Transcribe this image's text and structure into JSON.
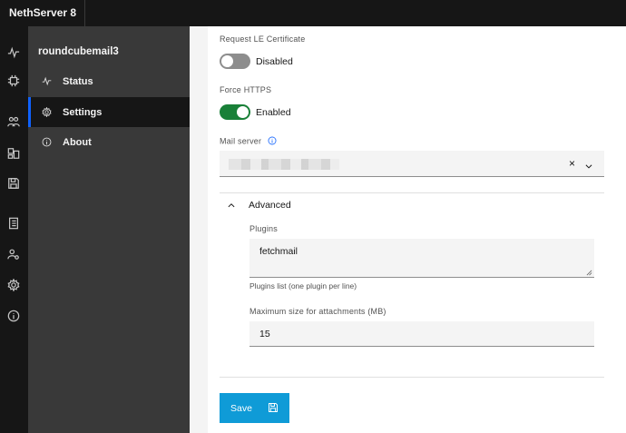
{
  "app": {
    "title": "NethServer 8"
  },
  "rail": {
    "icons": [
      "activity-icon",
      "chip-icon",
      "users-icon",
      "apps-icon",
      "save-disk-icon",
      "notebook-icon",
      "user-settings-icon",
      "gear-icon",
      "info-icon"
    ]
  },
  "appnav": {
    "title": "roundcubemail3",
    "items": [
      {
        "label": "Status",
        "icon": "activity-icon"
      },
      {
        "label": "Settings",
        "icon": "gear-icon",
        "active": true
      },
      {
        "label": "About",
        "icon": "info-icon"
      }
    ]
  },
  "form": {
    "le_cert": {
      "label": "Request LE Certificate",
      "state": "Disabled",
      "on": false
    },
    "force_https": {
      "label": "Force HTTPS",
      "state": "Enabled",
      "on": true
    },
    "mail_server": {
      "label": "Mail server",
      "clear": "×"
    },
    "advanced": {
      "title": "Advanced",
      "plugins": {
        "label": "Plugins",
        "value": "fetchmail",
        "helper": "Plugins list (one plugin per line)"
      },
      "max_attach": {
        "label": "Maximum size for attachments (MB)",
        "value": "15"
      }
    },
    "save_label": "Save"
  },
  "colors": {
    "accent": "#0f62fe",
    "toggle_on": "#198038",
    "save_button": "#0f9bd7",
    "header_bg": "#161616",
    "nav_bg": "#393939"
  }
}
